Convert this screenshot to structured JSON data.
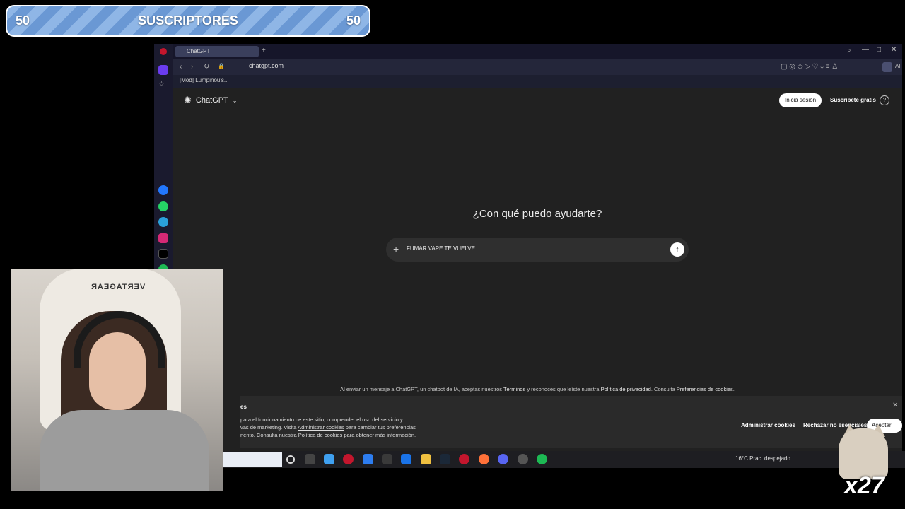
{
  "overlay": {
    "sub_count_left": "50",
    "sub_label": "SUSCRIPTORES",
    "sub_count_right": "50",
    "multiplier": "x27",
    "chair_text": "VERTAGEAR"
  },
  "browser": {
    "tab_title": "ChatGPT",
    "url": "chatgpt.com",
    "bookmark": "[Mod] Lumpinou's...",
    "ai_label": "AI"
  },
  "chatgpt": {
    "brand": "ChatGPT",
    "login_label": "Inicia sesión",
    "signup_label": "Suscríbete gratis",
    "headline": "¿Con qué puedo ayudarte?",
    "prompt_value": "FUMAR VAPE TE VUELVE",
    "disclaimer_pre": "Al enviar un mensaje a ChatGPT, un chatbot de IA, aceptas nuestros",
    "terms_link": "Términos",
    "disclaimer_mid": "y reconoces que leíste nuestra",
    "privacy_link": "Política de privacidad",
    "disclaimer_mid2": ". Consulta",
    "cookie_prefs_link": "Preferencias de cookies",
    "disclaimer_end": "."
  },
  "cookies": {
    "title": "es",
    "line1": "para el funcionamiento de este sitio, comprender el uso del servicio y",
    "line2_pre": "vas de marketing. Visita",
    "manage_link": "Administrar cookies",
    "line2_post": "para cambiar tus preferencias",
    "line3_pre": "nento. Consulta nuestra",
    "policy_link": "Política de cookies",
    "line3_post": "para obtener más información.",
    "manage_btn": "Administrar cookies",
    "reject_btn": "Rechazar no esenciales",
    "accept_btn": "Aceptar todo"
  },
  "taskbar": {
    "weather": "16°C  Prac. despejado"
  },
  "colors": {
    "page_bg": "#212121",
    "composer_bg": "#2f2f2f",
    "banner_stripe": "#8fb6e6"
  }
}
